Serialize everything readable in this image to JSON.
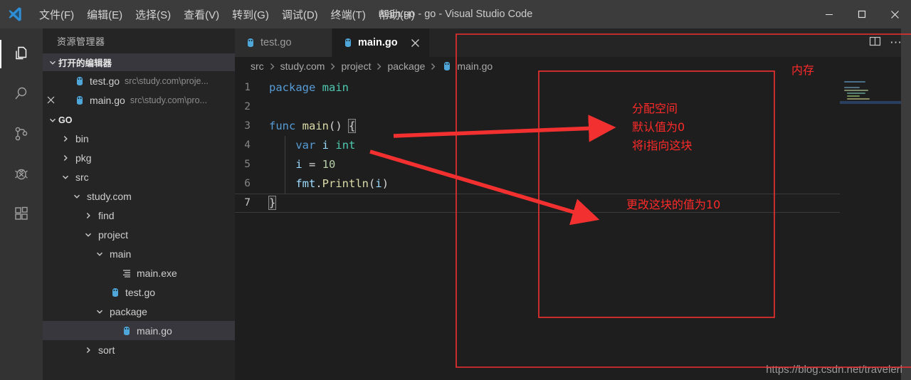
{
  "window": {
    "title": "main.go - go - Visual Studio Code",
    "logo_icon": "vscode-logo",
    "minimize_icon": "minimize-icon",
    "maximize_icon": "maximize-icon",
    "close_icon": "close-icon"
  },
  "menubar": {
    "items": [
      {
        "label": "文件(F)",
        "mnemonic": "F"
      },
      {
        "label": "编辑(E)",
        "mnemonic": "E"
      },
      {
        "label": "选择(S)",
        "mnemonic": "S"
      },
      {
        "label": "查看(V)",
        "mnemonic": "V"
      },
      {
        "label": "转到(G)",
        "mnemonic": "G"
      },
      {
        "label": "调试(D)",
        "mnemonic": "D"
      },
      {
        "label": "终端(T)",
        "mnemonic": "T"
      },
      {
        "label": "帮助(H)",
        "mnemonic": "H"
      }
    ]
  },
  "activitybar": {
    "items": [
      {
        "icon": "files-explorer-icon",
        "name": "explorer",
        "active": true
      },
      {
        "icon": "search-icon",
        "name": "search",
        "active": false
      },
      {
        "icon": "source-control-icon",
        "name": "source-control",
        "active": false
      },
      {
        "icon": "debug-icon",
        "name": "debug",
        "active": false
      },
      {
        "icon": "extensions-icon",
        "name": "extensions",
        "active": false
      }
    ]
  },
  "sidebar": {
    "title": "资源管理器",
    "open_editors": {
      "header": "打开的编辑器",
      "expanded": true,
      "items": [
        {
          "name": "test.go",
          "description": "src\\study.com\\proje...",
          "icon": "go-file-icon",
          "dirty": false,
          "closable": false
        },
        {
          "name": "main.go",
          "description": "src\\study.com\\pro...",
          "icon": "go-file-icon",
          "dirty": false,
          "closable": true
        }
      ]
    },
    "project": {
      "header": "GO",
      "expanded": true,
      "tree": [
        {
          "label": "bin",
          "type": "folder",
          "depth": 1,
          "expanded": false,
          "selected": false
        },
        {
          "label": "pkg",
          "type": "folder",
          "depth": 1,
          "expanded": false,
          "selected": false
        },
        {
          "label": "src",
          "type": "folder",
          "depth": 1,
          "expanded": true,
          "selected": false
        },
        {
          "label": "study.com",
          "type": "folder",
          "depth": 2,
          "expanded": true,
          "selected": false
        },
        {
          "label": "find",
          "type": "folder",
          "depth": 3,
          "expanded": false,
          "selected": false
        },
        {
          "label": "project",
          "type": "folder",
          "depth": 3,
          "expanded": true,
          "selected": false
        },
        {
          "label": "main",
          "type": "folder",
          "depth": 4,
          "expanded": true,
          "selected": false
        },
        {
          "label": "main.exe",
          "type": "exe",
          "depth": 5,
          "expanded": false,
          "selected": false
        },
        {
          "label": "test.go",
          "type": "go",
          "depth": 4,
          "expanded": false,
          "selected": false
        },
        {
          "label": "package",
          "type": "folder",
          "depth": 4,
          "expanded": true,
          "selected": false
        },
        {
          "label": "main.go",
          "type": "go",
          "depth": 5,
          "expanded": false,
          "selected": true
        },
        {
          "label": "sort",
          "type": "folder",
          "depth": 3,
          "expanded": false,
          "selected": false
        }
      ]
    }
  },
  "editor": {
    "tabs": [
      {
        "label": "test.go",
        "icon": "go-file-icon",
        "active": false
      },
      {
        "label": "main.go",
        "icon": "go-file-icon",
        "active": true
      }
    ],
    "tab_actions": [
      {
        "icon": "split-editor-icon",
        "name": "split-editor"
      },
      {
        "icon": "more-actions-icon",
        "name": "more-actions",
        "label": "⋯"
      }
    ],
    "breadcrumbs": [
      "src",
      "study.com",
      "project",
      "package",
      "main.go"
    ],
    "breadcrumb_separator": "›",
    "language": "go",
    "code_lines": [
      {
        "number": "1",
        "current": false,
        "indent_guide": false,
        "tokens": [
          {
            "text": "package",
            "cls": "tok-kw"
          },
          {
            "text": " ",
            "cls": "tok-plain"
          },
          {
            "text": "main",
            "cls": "tok-pkg"
          }
        ]
      },
      {
        "number": "2",
        "current": false,
        "indent_guide": false,
        "tokens": []
      },
      {
        "number": "3",
        "current": false,
        "indent_guide": false,
        "tokens": [
          {
            "text": "func",
            "cls": "tok-kw"
          },
          {
            "text": " ",
            "cls": "tok-plain"
          },
          {
            "text": "main",
            "cls": "tok-fn"
          },
          {
            "text": "()",
            "cls": "tok-paren"
          },
          {
            "text": " ",
            "cls": "tok-plain"
          },
          {
            "text": "{",
            "cls": "tok-plain bracket-box"
          }
        ]
      },
      {
        "number": "4",
        "current": false,
        "indent_guide": true,
        "tokens": [
          {
            "text": "    ",
            "cls": "tok-plain"
          },
          {
            "text": "var",
            "cls": "tok-kw"
          },
          {
            "text": " ",
            "cls": "tok-plain"
          },
          {
            "text": "i",
            "cls": "tok-var"
          },
          {
            "text": " ",
            "cls": "tok-plain"
          },
          {
            "text": "int",
            "cls": "tok-type"
          }
        ]
      },
      {
        "number": "5",
        "current": false,
        "indent_guide": true,
        "tokens": [
          {
            "text": "    ",
            "cls": "tok-plain"
          },
          {
            "text": "i",
            "cls": "tok-var"
          },
          {
            "text": " = ",
            "cls": "tok-plain"
          },
          {
            "text": "10",
            "cls": "tok-num"
          }
        ]
      },
      {
        "number": "6",
        "current": false,
        "indent_guide": true,
        "tokens": [
          {
            "text": "    ",
            "cls": "tok-plain"
          },
          {
            "text": "fmt",
            "cls": "tok-var"
          },
          {
            "text": ".",
            "cls": "tok-plain"
          },
          {
            "text": "Println",
            "cls": "tok-fn"
          },
          {
            "text": "(",
            "cls": "tok-paren"
          },
          {
            "text": "i",
            "cls": "tok-var"
          },
          {
            "text": ")",
            "cls": "tok-paren"
          }
        ]
      },
      {
        "number": "7",
        "current": true,
        "indent_guide": false,
        "tokens": [
          {
            "text": "}",
            "cls": "tok-plain bracket-box"
          }
        ]
      }
    ]
  },
  "annotations": {
    "color": "#ff2a2a",
    "memory_label": "内存",
    "note_alloc": "分配空间\n默认值为0\n将i指向这块",
    "note_update": "更改这块的值为10"
  },
  "watermark": "https://blog.csdn.net/travelerl"
}
